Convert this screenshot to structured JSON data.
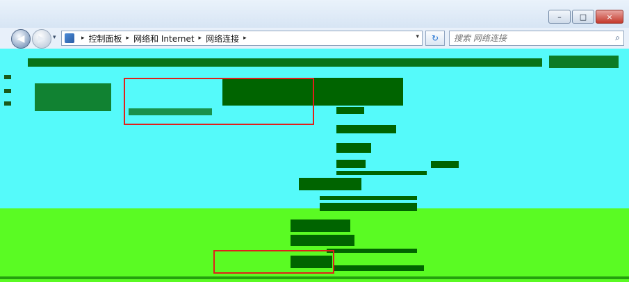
{
  "window": {
    "controls": {
      "minimize": "–",
      "maximize": "□",
      "close": "×"
    }
  },
  "address_bar": {
    "back_icon": "back-arrow-icon",
    "forward_icon": "forward-arrow-icon",
    "breadcrumb": [
      "控制面板",
      "网络和 Internet",
      "网络连接"
    ],
    "separator": "▸",
    "dropdown_glyph": "▾",
    "refresh_glyph": "↻"
  },
  "search": {
    "placeholder": "搜索 网络连接",
    "icon": "search-icon",
    "glyph": "⌕"
  },
  "colors": {
    "content_top": "#55fafa",
    "content_bottom": "#5afb23",
    "dark_green": "#006400",
    "highlight_red": "#e0201b"
  }
}
